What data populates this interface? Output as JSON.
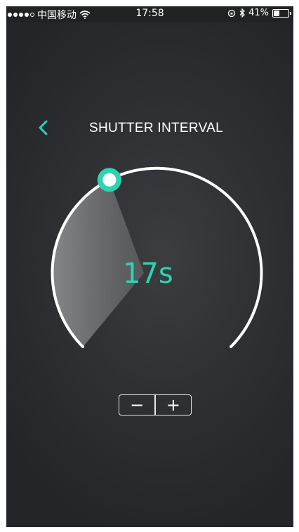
{
  "status_bar": {
    "carrier": "中国移动",
    "time": "17:58",
    "battery_percent": "41%",
    "battery_level": 0.41,
    "signal_bars_filled": 4,
    "signal_bars_total": 5
  },
  "header": {
    "title": "SHUTTER INTERVAL",
    "back_icon": "chevron-left-icon"
  },
  "dial": {
    "value_label": "17s",
    "handle_angle_deg": 243,
    "accent_color": "#2fd3b2"
  },
  "stepper": {
    "decrement_label": "−",
    "increment_label": "+"
  }
}
